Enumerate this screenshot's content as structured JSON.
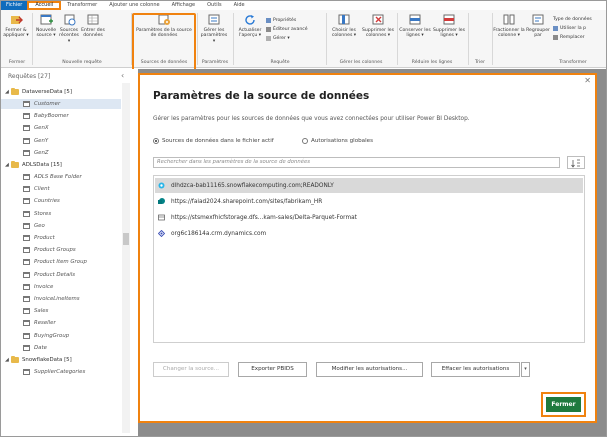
{
  "tabs": {
    "file": "Fichier",
    "accueil": "Accueil",
    "transformer": "Transformer",
    "ajouter_colonne": "Ajouter une colonne",
    "affichage": "Affichage",
    "outils": "Outils",
    "aide": "Aide"
  },
  "ribbon": {
    "fermer_appliquer": "Fermer & appliquer ▾",
    "nouvelle_source": "Nouvelle source ▾",
    "sources_recentes": "Sources récentes ▾",
    "entrer_donnees": "Entrer des données",
    "parametres_source": "Paramètres de la source de données",
    "gerer_parametres": "Gérer les paramètres ▾",
    "actualiser_apercu": "Actualiser l'aperçu ▾",
    "proprietes": "Propriétés",
    "editeur_avance": "Éditeur avancé",
    "gerer": "Gérer ▾",
    "choisir_colonnes": "Choisir les colonnes ▾",
    "supprimer_colonnes": "Supprimer les colonnes ▾",
    "conserver_lignes": "Conserver les lignes ▾",
    "supprimer_lignes": "Supprimer les lignes ▾",
    "fractionner_colonne": "Fractionner la colonne ▾",
    "regrouper_par": "Regrouper par",
    "type_donnees": "Type de données",
    "utiliser_premiere_ligne": "Utiliser la p",
    "remplacer_valeurs": "Remplacer",
    "groups": {
      "fermer": "Fermer",
      "nouvelle_requete": "Nouvelle requête",
      "sources_donnees": "Sources de données",
      "parametres": "Paramètres",
      "requete": "Requête",
      "gerer_colonnes": "Gérer les colonnes",
      "reduire_lignes": "Réduire les lignes",
      "trier": "Trier",
      "transformer": "Transformer"
    }
  },
  "queries": {
    "title": "Requêtes [27]",
    "collapse": "‹",
    "groups": [
      {
        "name": "DataverseData [5]",
        "items": [
          "Customer",
          "BabyBoomer",
          "GenX",
          "GenY",
          "GenZ"
        ]
      },
      {
        "name": "ADLSData [15]",
        "items": [
          "ADLS Base Folder",
          "Client",
          "Countries",
          "Stores",
          "Geo",
          "Product",
          "Product Groups",
          "Product Item Group",
          "Product Details",
          "Invoice",
          "InvoiceLineItems",
          "Sales",
          "Reseller",
          "BuyingGroup",
          "Date"
        ]
      },
      {
        "name": "SnowflakeData [5]",
        "items": [
          "SupplierCategories"
        ]
      }
    ]
  },
  "dialog": {
    "title": "Paramètres de la source de données",
    "description": "Gérer les paramètres pour les sources de données que vous avez connectées pour utiliser Power BI Desktop.",
    "radio_current": "Sources de données dans le fichier actif",
    "radio_global": "Autorisations globales",
    "search_placeholder": "Rechercher dans les paramètres de la source de données",
    "sources": [
      "dlhdzca-bab11165.snowflakecomputing.com;READONLY",
      "https://faiad2024.sharepoint.com/sites/fabrikam_HR",
      "https://stsmexfhicfstorage.dfs...kam-sales/Delta-Parquet-Format",
      "org6c18614a.crm.dynamics.com"
    ],
    "btn_change_source": "Changer la source...",
    "btn_export_pbids": "Exporter PBIDS",
    "btn_edit_permissions": "Modifier les autorisations...",
    "btn_clear_permissions": "Effacer les autorisations",
    "btn_close": "Fermer",
    "close_x": "✕"
  },
  "colors": {
    "highlight": "#f0820f",
    "file_tab": "#0f6cbd",
    "primary_button": "#1f7a3e"
  }
}
